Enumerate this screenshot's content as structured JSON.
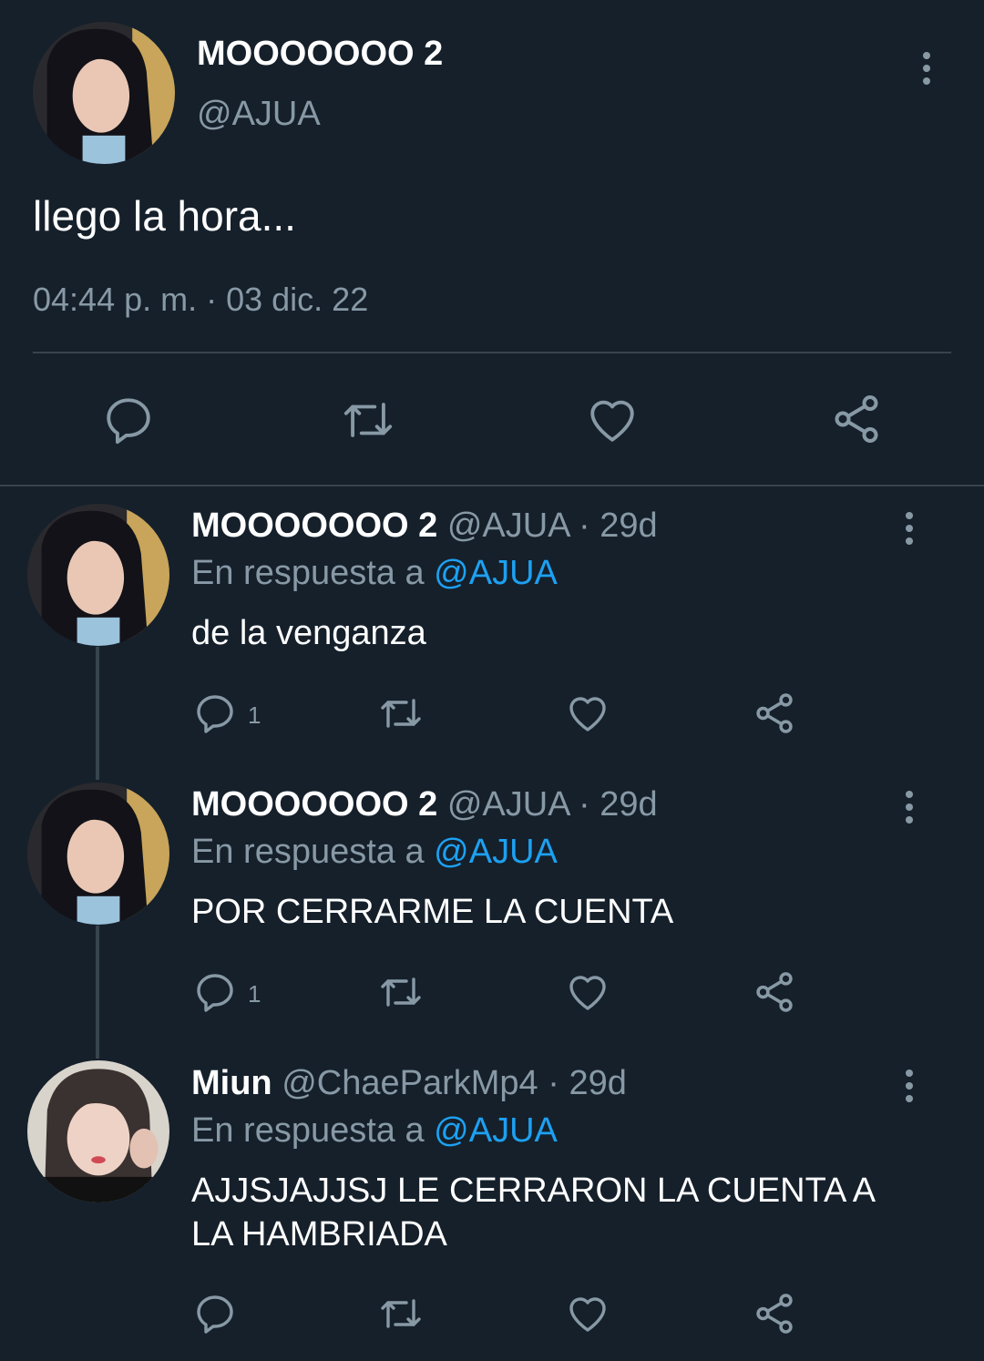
{
  "main_tweet": {
    "display_name": "MOOOOOOO 2",
    "handle": "@AJUA",
    "text": "llego la hora...",
    "timestamp": "04:44 p. m. · 03 dic. 22",
    "icons": [
      "reply-icon",
      "retweet-icon",
      "like-icon",
      "share-icon"
    ]
  },
  "replies": [
    {
      "display_name": "MOOOOOOO 2",
      "handle": "@AJUA",
      "age": "· 29d",
      "reply_prefix": "En respuesta a",
      "reply_to": "@AJUA",
      "text": "de la venganza",
      "reply_count": "1"
    },
    {
      "display_name": "MOOOOOOO 2",
      "handle": "@AJUA",
      "age": "· 29d",
      "reply_prefix": "En respuesta a",
      "reply_to": "@AJUA",
      "text": "POR CERRARME LA CUENTA",
      "reply_count": "1"
    },
    {
      "display_name": "Miun",
      "handle": "@ChaeParkMp4",
      "age": "· 29d",
      "reply_prefix": "En respuesta a",
      "reply_to": "@AJUA",
      "text_line1": "AJJSJAJJSJ LE CERRARON LA CUENTA A",
      "text_line2": "LA HAMBRIADA",
      "reply_count": ""
    }
  ],
  "colors": {
    "background": "#15202b",
    "muted": "#8899a6",
    "link": "#1da1f2",
    "divider": "#38444d"
  }
}
